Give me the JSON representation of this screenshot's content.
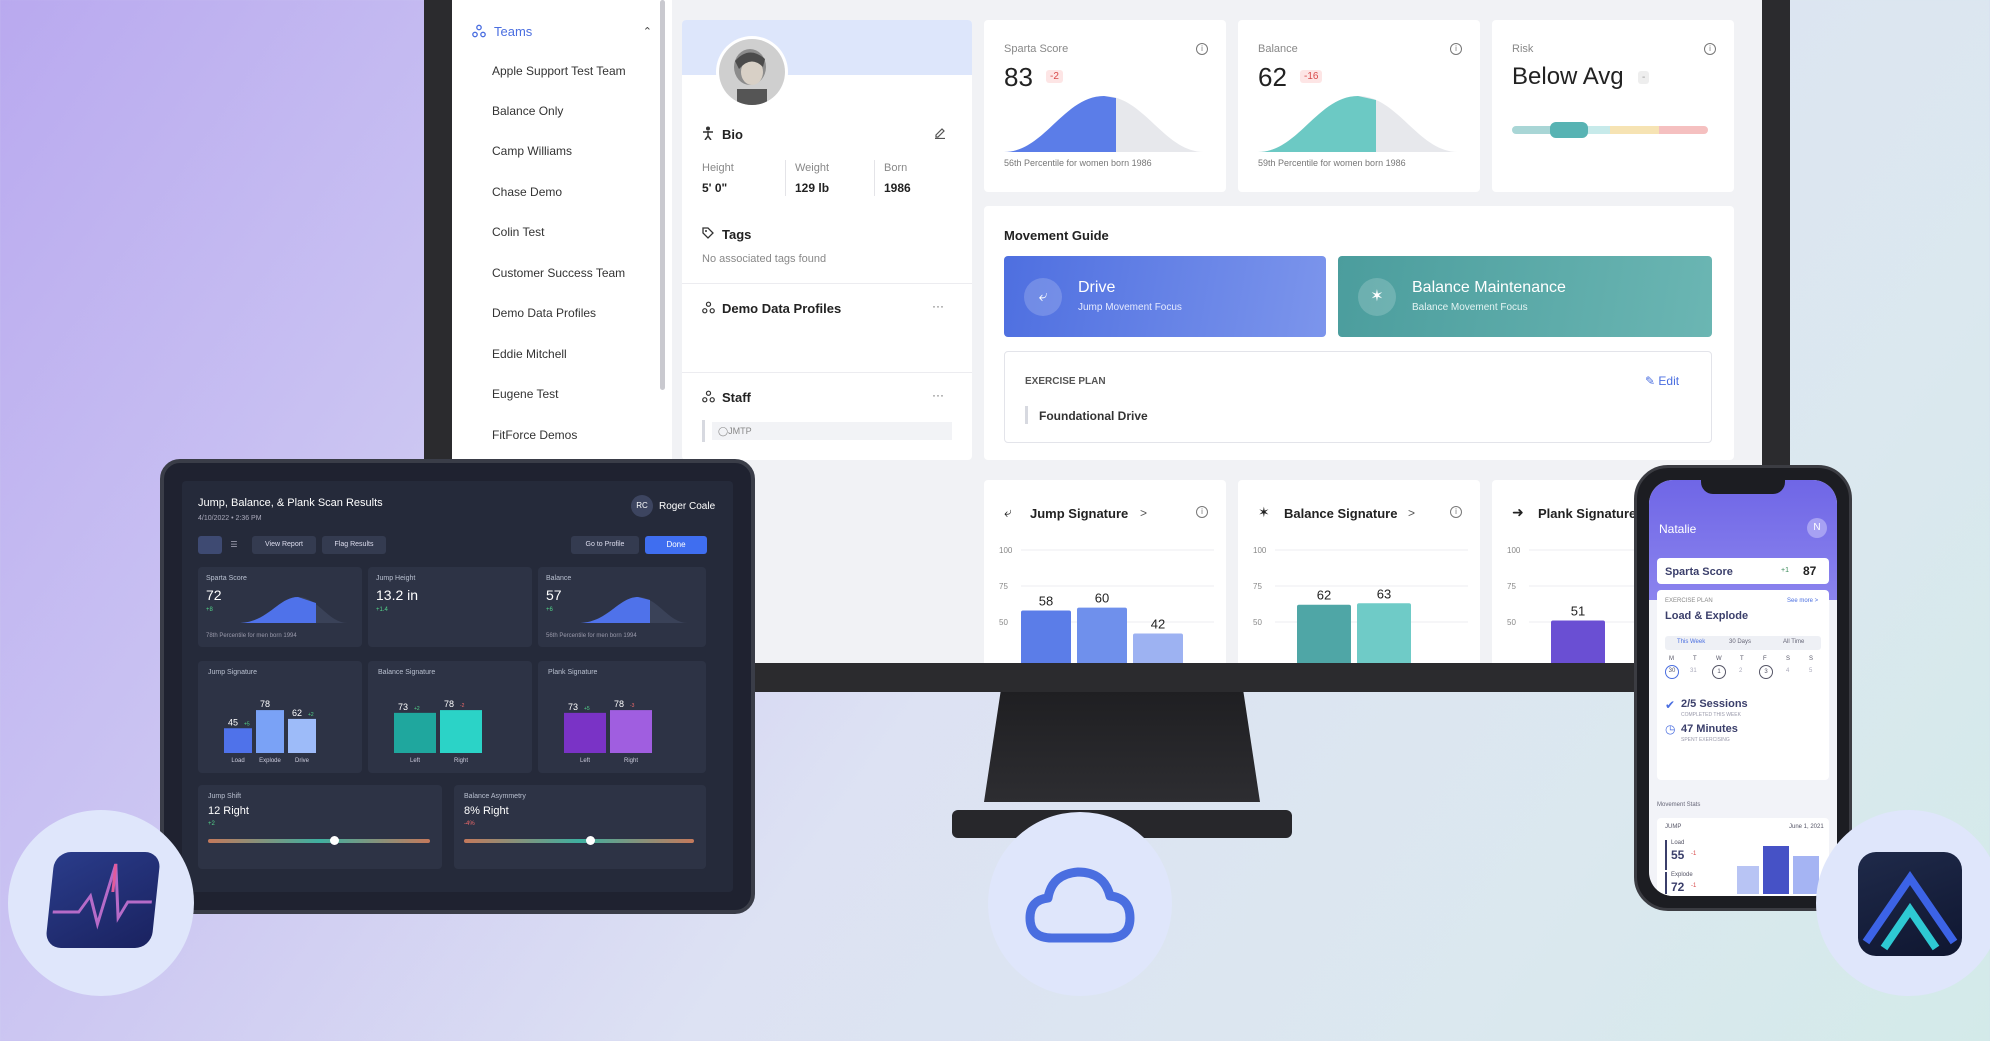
{
  "sidebar": {
    "teams_label": "Teams",
    "items": [
      "Apple Support Test Team",
      "Balance Only",
      "Camp Williams",
      "Chase Demo",
      "Colin Test",
      "Customer Success Team",
      "Demo Data Profiles",
      "Eddie Mitchell",
      "Eugene Test",
      "FitForce Demos"
    ]
  },
  "profile": {
    "bio_label": "Bio",
    "height_label": "Height",
    "height": "5' 0\"",
    "weight_label": "Weight",
    "weight": "129 lb",
    "born_label": "Born",
    "born": "1986",
    "tags_label": "Tags",
    "tags_empty": "No associated tags found",
    "group_label": "Demo Data Profiles",
    "staff_label": "Staff",
    "staff_tag": "JMTP",
    "more": "···"
  },
  "metrics": {
    "sparta": {
      "label": "Sparta Score",
      "value": "83",
      "delta": "-2",
      "caption": "56th Percentile for women born 1986",
      "percentile": 56
    },
    "balance": {
      "label": "Balance",
      "value": "62",
      "delta": "-16",
      "caption": "59th Percentile for women born 1986",
      "percentile": 59
    },
    "risk": {
      "label": "Risk",
      "value": "Below Avg",
      "delta": "-"
    }
  },
  "movement": {
    "title": "Movement Guide",
    "drive_title": "Drive",
    "drive_sub": "Jump Movement Focus",
    "balance_title": "Balance Maintenance",
    "balance_sub": "Balance Movement Focus",
    "plan_label": "EXERCISE PLAN",
    "edit_label": "Edit",
    "plan_item": "Foundational Drive"
  },
  "signatures": {
    "jump": {
      "title": "Jump Signature",
      "chevron": ">",
      "ticks": [
        "100",
        "75",
        "50"
      ],
      "values": [
        58,
        60,
        42
      ]
    },
    "balance": {
      "title": "Balance Signature",
      "chevron": ">",
      "ticks": [
        "100",
        "75",
        "50"
      ],
      "values": [
        62,
        63
      ]
    },
    "plank": {
      "title": "Plank Signature",
      "ticks": [
        "100",
        "75",
        "50"
      ],
      "values": [
        51
      ]
    }
  },
  "tablet": {
    "title": "Jump, Balance, & Plank Scan Results",
    "date": "4/10/2022 • 2:36 PM",
    "user_initials": "RC",
    "user_name": "Roger Coale",
    "view_report": "View Report",
    "flag_results": "Flag Results",
    "go_profile": "Go to Profile",
    "done": "Done",
    "sparta": {
      "label": "Sparta Score",
      "value": "72",
      "delta": "+8",
      "caption": "78th Percentile for men born 1994"
    },
    "jump_height": {
      "label": "Jump Height",
      "value": "13.2 in",
      "delta": "+1.4"
    },
    "balance": {
      "label": "Balance",
      "value": "57",
      "delta": "+6",
      "caption": "56th Percentile for men born 1994"
    },
    "jump_sig": {
      "label": "Jump Signature",
      "values": [
        45,
        78,
        62
      ],
      "labels": [
        "Load",
        "Explode",
        "Drive"
      ],
      "deltas": [
        "+5",
        "",
        "+2"
      ]
    },
    "balance_sig": {
      "label": "Balance Signature",
      "values": [
        73,
        78
      ],
      "labels": [
        "Left",
        "Right"
      ],
      "deltas": [
        "+2",
        "-2"
      ]
    },
    "plank_sig": {
      "label": "Plank Signature",
      "values": [
        73,
        78
      ],
      "labels": [
        "Left",
        "Right"
      ],
      "deltas": [
        "+5",
        "-3"
      ]
    },
    "jump_shift": {
      "label": "Jump Shift",
      "value": "12 Right",
      "delta": "+2"
    },
    "balance_asym": {
      "label": "Balance Asymmetry",
      "value": "8% Right",
      "delta": "-4%"
    }
  },
  "phone": {
    "name": "Natalie",
    "initial": "N",
    "score_label": "Sparta Score",
    "score_delta": "+1",
    "score": "87",
    "plan_label": "EXERCISE PLAN",
    "see_more": "See more >",
    "plan_title": "Load & Explode",
    "tabs": [
      "This Week",
      "30 Days",
      "All Time"
    ],
    "days": [
      "M",
      "T",
      "W",
      "T",
      "F",
      "S",
      "S"
    ],
    "dates": [
      "30",
      "31",
      "1",
      "2",
      "3",
      "4",
      "5"
    ],
    "sessions": "2/5 Sessions",
    "sessions_sub": "COMPLETED THIS WEEK",
    "minutes": "47 Minutes",
    "minutes_sub": "SPENT EXERCISING",
    "stats_label": "Movement Stats",
    "jump_label": "JUMP",
    "stats_date": "June 1, 2021",
    "load_label": "Load",
    "load_value": "55",
    "load_delta": "-1",
    "explode_label": "Explode",
    "explode_value": "72",
    "explode_delta": "-1"
  },
  "colors": {
    "accent": "#4a6ee0",
    "drive": "#5b7de8",
    "teal": "#4fa6a6",
    "purple": "#7b5fd6"
  }
}
